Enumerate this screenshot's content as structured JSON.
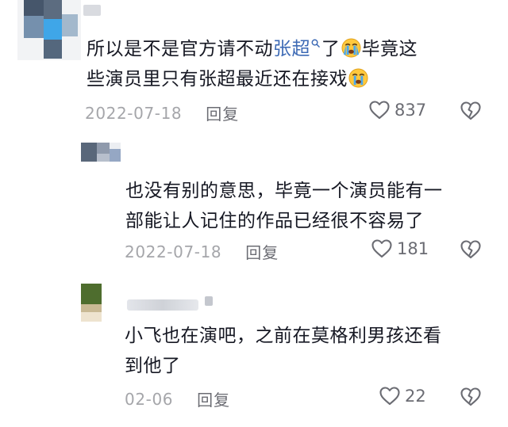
{
  "comments": [
    {
      "text_a": "所以是不是官方请不动",
      "keyword": "张超",
      "text_b": "了",
      "text_c": "毕竟这",
      "text_d": "些演员里只有张超最近还在接戏",
      "emoji": "crying-face-icon",
      "date": "2022-07-18",
      "reply_label": "回复",
      "likes": "837"
    },
    {
      "line1": "也没有别的意思，毕竟一个演员能有一",
      "line2": "部能让人记住的作品已经很不容易了",
      "date": "2022-07-18",
      "reply_label": "回复",
      "likes": "181"
    },
    {
      "line1": "小飞也在演吧，之前在莫格利男孩还看",
      "line2": "到他了",
      "date": "02-06",
      "reply_label": "回复",
      "likes": "22"
    }
  ],
  "colors": {
    "text": "#161823",
    "keyword": "#3d6ab5",
    "meta": "#a5a6aa",
    "reply": "#6b6c73"
  }
}
